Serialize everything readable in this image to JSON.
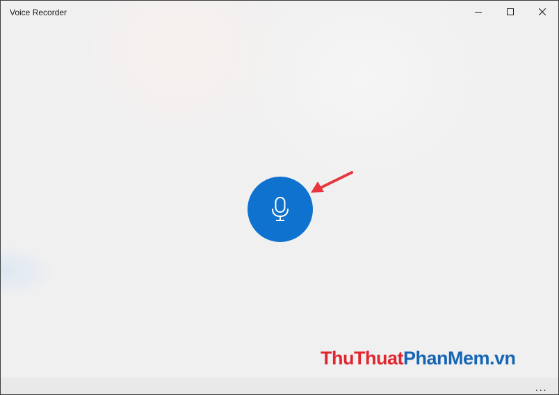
{
  "window": {
    "title": "Voice Recorder"
  },
  "caption_buttons": {
    "minimize_icon": "minimize-icon",
    "maximize_icon": "maximize-icon",
    "close_icon": "close-icon"
  },
  "main": {
    "record_icon": "microphone-icon",
    "record_color": "#0f72cf",
    "annotation_arrow_color": "#e8363f"
  },
  "watermark": {
    "part1": "ThuThuat",
    "part2": "PhanMem.vn"
  },
  "bottom_bar": {
    "more_label": "..."
  }
}
